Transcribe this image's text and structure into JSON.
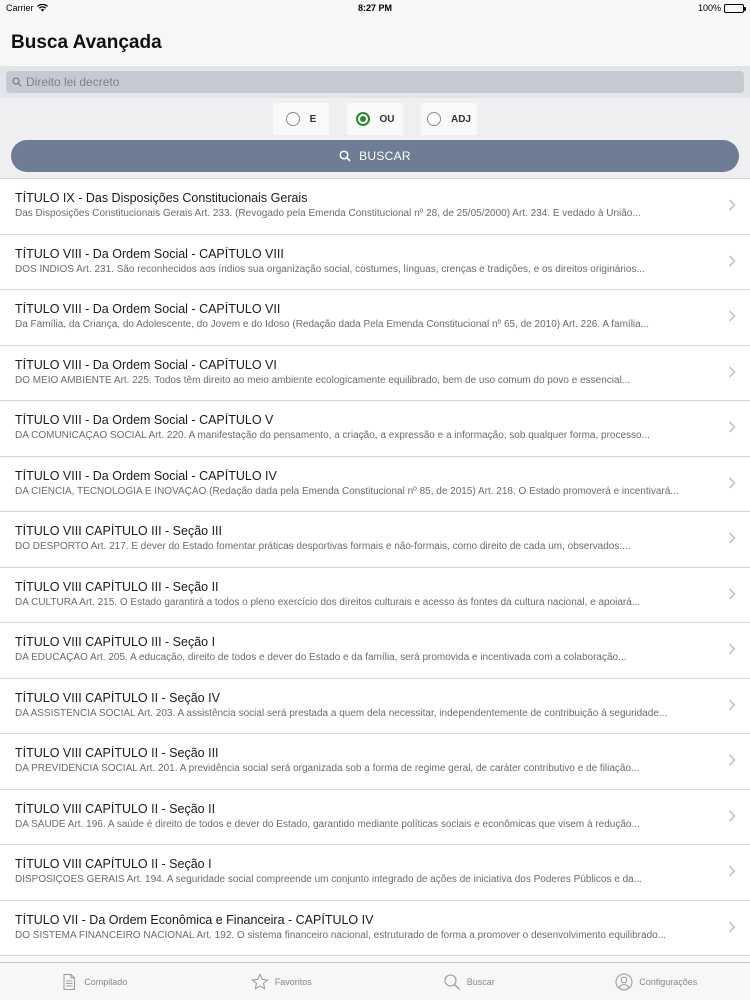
{
  "status_bar": {
    "carrier": "Carrier",
    "time": "8:27 PM",
    "battery": "100%"
  },
  "header": {
    "title": "Busca Avançada"
  },
  "search": {
    "placeholder": "Direito lei decreto",
    "value": ""
  },
  "radio": {
    "options": [
      {
        "label": "E",
        "checked": false
      },
      {
        "label": "OU",
        "checked": true
      },
      {
        "label": "ADJ",
        "checked": false
      }
    ]
  },
  "buscar": {
    "label": "BUSCAR"
  },
  "results": [
    {
      "title": "TÍTULO IX - Das Disposições Constitucionais Gerais",
      "subtitle": "Das Disposições Constitucionais Gerais Art. 233. (Revogado pela Emenda Constitucional nº 28, de 25/05/2000) Art. 234. É vedado à União..."
    },
    {
      "title": "TÍTULO VIII - Da Ordem Social - CAPÍTULO VIII",
      "subtitle": "DOS ÍNDIOS Art. 231. São reconhecidos aos índios sua organização social, costumes, línguas, crenças e tradições, e os direitos originários..."
    },
    {
      "title": "TÍTULO VIII - Da Ordem Social - CAPÍTULO VII",
      "subtitle": "Da Família, da Criança, do Adolescente, do Jovem e do Idoso  (Redação dada Pela Emenda Constitucional nº 65, de 2010) Art. 226. A família..."
    },
    {
      "title": "TÍTULO VIII - Da Ordem Social - CAPÍTULO VI",
      "subtitle": "DO MEIO AMBIENTE Art. 225. Todos têm direito ao meio ambiente ecologicamente equilibrado, bem de uso comum do povo e essencial..."
    },
    {
      "title": "TÍTULO VIII - Da Ordem Social - CAPÍTULO V",
      "subtitle": "DA COMUNICAÇÃO SOCIAL Art. 220. A manifestação do pensamento, a criação, a expressão e a informação, sob qualquer forma, processo..."
    },
    {
      "title": "TÍTULO VIII - Da Ordem Social - CAPÍTULO IV",
      "subtitle": "DA CIÊNCIA, TECNOLOGIA E INOVAÇÃO (Redação dada pela Emenda Constitucional nº 85, de 2015)  Art. 218. O Estado promoverá e incentivará..."
    },
    {
      "title": "TÍTULO VIII CAPÍTULO III - Seção III",
      "subtitle": "DO DESPORTO Art. 217. É dever do Estado fomentar práticas desportivas formais e não-formais, como direito de cada um, observados:..."
    },
    {
      "title": "TÍTULO VIII CAPÍTULO III - Seção II",
      "subtitle": "DA CULTURA Art. 215. O Estado garantirá a todos o pleno exercício dos direitos culturais e acesso às fontes da cultura nacional, e apoiará..."
    },
    {
      "title": "TÍTULO VIII CAPÍTULO III - Seção I",
      "subtitle": "DA EDUCAÇÃO Art. 205. A educação, direito de todos e dever do Estado e da família, será promovida e incentivada com a colaboração..."
    },
    {
      "title": "TÍTULO VIII CAPÍTULO II - Seção IV",
      "subtitle": "DA ASSISTÊNCIA SOCIAL Art. 203. A assistência social será prestada a quem dela necessitar, independentemente de contribuição à seguridade..."
    },
    {
      "title": "TÍTULO VIII CAPÍTULO II - Seção III",
      "subtitle": "DA PREVIDÊNCIA SOCIAL  Art. 201. A previdência social será organizada sob a forma de regime geral, de caráter contributivo e de filiação..."
    },
    {
      "title": "TÍTULO VIII CAPÍTULO II - Seção II",
      "subtitle": "DA SAÚDE   Art. 196. A saúde é direito de todos e dever do Estado, garantido mediante políticas sociais e econômicas que visem à redução..."
    },
    {
      "title": "TÍTULO VIII CAPÍTULO II - Seção I",
      "subtitle": "DISPOSIÇÕES GERAIS Art. 194. A seguridade social compreende um conjunto integrado de ações de iniciativa dos Poderes Públicos e da..."
    },
    {
      "title": "TÍTULO VII - Da Ordem Econômica e Financeira - CAPÍTULO IV",
      "subtitle": "DO SISTEMA FINANCEIRO NACIONAL  Art. 192. O sistema financeiro nacional, estruturado de forma a promover o desenvolvimento equilibrado..."
    }
  ],
  "tab_bar": {
    "tabs": [
      {
        "label": "Compilado",
        "icon": "document-icon"
      },
      {
        "label": "Favoritos",
        "icon": "star-icon"
      },
      {
        "label": "Buscar",
        "icon": "search-icon"
      },
      {
        "label": "Configurações",
        "icon": "person-icon"
      }
    ]
  }
}
